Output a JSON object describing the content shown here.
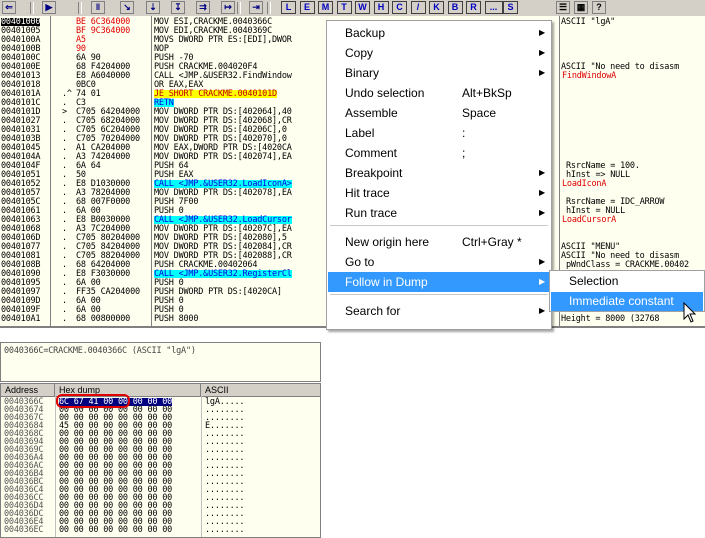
{
  "toolbar": {
    "buttons_left": [
      "⇐",
      "▶",
      "‖",
      "↘",
      "⇣",
      "↧",
      "⇉",
      "↦",
      "⇥"
    ],
    "letters": [
      "L",
      "E",
      "M",
      "T",
      "W",
      "H",
      "C",
      "/",
      "K",
      "B",
      "R",
      "...",
      "S"
    ],
    "right": [
      "☰",
      "▦",
      "?"
    ]
  },
  "cpu": {
    "rows": [
      {
        "addr": "00401000",
        "mark": "",
        "hex": "BE 6C364000",
        "asm": "MOV ESI,CRACKME.0040366C",
        "cmt": "ASCII \"lgA\"",
        "addr_hl": true,
        "hex_red": true
      },
      {
        "addr": "00401005",
        "mark": "",
        "hex": "BF 9C364000",
        "asm": "MOV EDI,CRACKME.0040369C",
        "cmt": "",
        "hex_red": true
      },
      {
        "addr": "0040100A",
        "mark": "",
        "hex": "A5",
        "asm": "MOVS DWORD PTR ES:[EDI],DWOR",
        "cmt": "",
        "hex_red": true
      },
      {
        "addr": "0040100B",
        "mark": "",
        "hex": "90",
        "asm": "NOP",
        "cmt": "",
        "hex_red": true
      },
      {
        "addr": "0040100C",
        "mark": "",
        "hex": "6A 90",
        "asm": "PUSH -70",
        "cmt": ""
      },
      {
        "addr": "0040100E",
        "mark": "",
        "hex": "68 F4204000",
        "asm": "PUSH CRACKME.004020F4",
        "cmt": "ASCII \"No need to disasm"
      },
      {
        "addr": "00401013",
        "mark": "",
        "hex": "E8 A6040000",
        "asm": "CALL <JMP.&USER32.FindWindow",
        "cmt": "FindWindowA",
        "cmt_red": true
      },
      {
        "addr": "00401018",
        "mark": "",
        "hex": "0BC0",
        "asm": "OR EAX,EAX",
        "cmt": ""
      },
      {
        "addr": "0040101A",
        "mark": ".^",
        "hex": "74 01",
        "asm": "JE SHORT CRACKME.0040101D",
        "cmt": "",
        "asm_style": "yellow"
      },
      {
        "addr": "0040101C",
        "mark": ".",
        "hex": "C3",
        "asm": "RETN",
        "cmt": "",
        "asm_style": "cyan"
      },
      {
        "addr": "0040101D",
        "mark": ">",
        "hex": "C705 64204000",
        "asm": "MOV DWORD PTR DS:[402064],40",
        "cmt": ""
      },
      {
        "addr": "00401027",
        "mark": ".",
        "hex": "C705 68204000",
        "asm": "MOV DWORD PTR DS:[402068],CR",
        "cmt": ""
      },
      {
        "addr": "00401031",
        "mark": ".",
        "hex": "C705 6C204000",
        "asm": "MOV DWORD PTR DS:[40206C],0",
        "cmt": ""
      },
      {
        "addr": "0040103B",
        "mark": ".",
        "hex": "C705 70204000",
        "asm": "MOV DWORD PTR DS:[402070],0",
        "cmt": ""
      },
      {
        "addr": "00401045",
        "mark": ".",
        "hex": "A1 CA204000",
        "asm": "MOV EAX,DWORD PTR DS:[4020CA",
        "cmt": ""
      },
      {
        "addr": "0040104A",
        "mark": ".",
        "hex": "A3 74204000",
        "asm": "MOV DWORD PTR DS:[402074],EA",
        "cmt": ""
      },
      {
        "addr": "0040104F",
        "mark": ".",
        "hex": "6A 64",
        "asm": "PUSH 64",
        "cmt": "RsrcName = 100.",
        "cmt_sub": true
      },
      {
        "addr": "00401051",
        "mark": ".",
        "hex": "50",
        "asm": "PUSH EAX",
        "cmt": "hInst => NULL",
        "cmt_sub": true
      },
      {
        "addr": "00401052",
        "mark": ".",
        "hex": "E8 D1030000",
        "asm": "CALL <JMP.&USER32.LoadIconA>",
        "cmt": "LoadIconA",
        "asm_style": "cyan",
        "cmt_red": true
      },
      {
        "addr": "00401057",
        "mark": ".",
        "hex": "A3 78204000",
        "asm": "MOV DWORD PTR DS:[402078],EA",
        "cmt": ""
      },
      {
        "addr": "0040105C",
        "mark": ".",
        "hex": "68 007F0000",
        "asm": "PUSH 7F00",
        "cmt": "RsrcName = IDC_ARROW",
        "cmt_sub": true
      },
      {
        "addr": "00401061",
        "mark": ".",
        "hex": "6A 00",
        "asm": "PUSH 0",
        "cmt": "hInst = NULL",
        "cmt_sub": true
      },
      {
        "addr": "00401063",
        "mark": ".",
        "hex": "E8 B0030000",
        "asm": "CALL <JMP.&USER32.LoadCursor",
        "cmt": "LoadCursorA",
        "asm_style": "cyan",
        "cmt_red": true
      },
      {
        "addr": "00401068",
        "mark": ".",
        "hex": "A3 7C204000",
        "asm": "MOV DWORD PTR DS:[40207C],EA",
        "cmt": ""
      },
      {
        "addr": "0040106D",
        "mark": ".",
        "hex": "C705 80204000",
        "asm": "MOV DWORD PTR DS:[402080],5",
        "cmt": ""
      },
      {
        "addr": "00401077",
        "mark": ".",
        "hex": "C705 84204000",
        "asm": "MOV DWORD PTR DS:[402084],CR",
        "cmt": "ASCII \"MENU\""
      },
      {
        "addr": "00401081",
        "mark": ".",
        "hex": "C705 88204000",
        "asm": "MOV DWORD PTR DS:[402088],CR",
        "cmt": "ASCII \"No need to disasm"
      },
      {
        "addr": "0040108B",
        "mark": ".",
        "hex": "68 64204000",
        "asm": "PUSH CRACKME.00402064",
        "cmt": "pWndClass = CRACKME.00402",
        "cmt_sub": true
      },
      {
        "addr": "00401090",
        "mark": ".",
        "hex": "E8 F3030000",
        "asm": "CALL <JMP.&USER32.RegisterCl",
        "cmt": "",
        "asm_style": "cyan"
      },
      {
        "addr": "00401095",
        "mark": ".",
        "hex": "6A 00",
        "asm": "PUSH 0",
        "cmt": ""
      },
      {
        "addr": "00401097",
        "mark": ".",
        "hex": "FF35 CA204000",
        "asm": "PUSH DWORD PTR DS:[4020CA]",
        "cmt": ""
      },
      {
        "addr": "0040109D",
        "mark": ".",
        "hex": "6A 00",
        "asm": "PUSH 0",
        "cmt": ""
      },
      {
        "addr": "0040109F",
        "mark": ".",
        "hex": "6A 00",
        "asm": "PUSH 0",
        "cmt": ""
      },
      {
        "addr": "004010A1",
        "mark": ".",
        "hex": "68 00800000",
        "asm": "PUSH 8000",
        "cmt": "Height = 8000 (32768"
      }
    ]
  },
  "menu": {
    "items": [
      {
        "label": "Backup",
        "shortcut": "",
        "arrow": true
      },
      {
        "label": "Copy",
        "shortcut": "",
        "arrow": true
      },
      {
        "label": "Binary",
        "shortcut": "",
        "arrow": true
      },
      {
        "label": "Undo selection",
        "shortcut": "Alt+BkSp",
        "arrow": false
      },
      {
        "label": "Assemble",
        "shortcut": "Space",
        "arrow": false
      },
      {
        "label": "Label",
        "shortcut": ":",
        "arrow": false
      },
      {
        "label": "Comment",
        "shortcut": ";",
        "arrow": false
      },
      {
        "label": "Breakpoint",
        "shortcut": "",
        "arrow": true
      },
      {
        "label": "Hit trace",
        "shortcut": "",
        "arrow": true
      },
      {
        "label": "Run trace",
        "shortcut": "",
        "arrow": true
      },
      {
        "label": "New origin here",
        "shortcut": "Ctrl+Gray *",
        "arrow": false
      },
      {
        "label": "Go to",
        "shortcut": "",
        "arrow": true
      },
      {
        "label": "Follow in Dump",
        "shortcut": "",
        "arrow": true,
        "active": true
      },
      {
        "label": "Search for",
        "shortcut": "",
        "arrow": true
      }
    ],
    "submenu": [
      {
        "label": "Selection",
        "active": false
      },
      {
        "label": "Immediate constant",
        "active": true
      }
    ]
  },
  "info": {
    "text": "0040366C=CRACKME.0040366C (ASCII \"lgA\")"
  },
  "dump": {
    "headers": [
      "Address",
      "Hex dump",
      "ASCII"
    ],
    "rows": [
      {
        "addr": "0040366C",
        "hex": "6C 67 41 00 00 00 00 00",
        "ascii": "lgA....."
      },
      {
        "addr": "00403674",
        "hex": "00 00 00 00 00 00 00 00",
        "ascii": "........"
      },
      {
        "addr": "0040367C",
        "hex": "00 00 00 00 00 00 00 00",
        "ascii": "........"
      },
      {
        "addr": "00403684",
        "hex": "45 00 00 00 00 00 00 00",
        "ascii": "E......."
      },
      {
        "addr": "0040368C",
        "hex": "00 00 00 00 00 00 00 00",
        "ascii": "........"
      },
      {
        "addr": "00403694",
        "hex": "00 00 00 00 00 00 00 00",
        "ascii": "........"
      },
      {
        "addr": "0040369C",
        "hex": "00 00 00 00 00 00 00 00",
        "ascii": "........"
      },
      {
        "addr": "004036A4",
        "hex": "00 00 00 00 00 00 00 00",
        "ascii": "........"
      },
      {
        "addr": "004036AC",
        "hex": "00 00 00 00 00 00 00 00",
        "ascii": "........"
      },
      {
        "addr": "004036B4",
        "hex": "00 00 00 00 00 00 00 00",
        "ascii": "........"
      },
      {
        "addr": "004036BC",
        "hex": "00 00 00 00 00 00 00 00",
        "ascii": "........"
      },
      {
        "addr": "004036C4",
        "hex": "00 00 00 00 00 00 00 00",
        "ascii": "........"
      },
      {
        "addr": "004036CC",
        "hex": "00 00 00 00 00 00 00 00",
        "ascii": "........"
      },
      {
        "addr": "004036D4",
        "hex": "00 00 00 00 00 00 00 00",
        "ascii": "........"
      },
      {
        "addr": "004036DC",
        "hex": "00 00 00 00 00 00 00 00",
        "ascii": "........"
      },
      {
        "addr": "004036E4",
        "hex": "00 00 00 00 00 00 00 00",
        "ascii": "........"
      },
      {
        "addr": "004036EC",
        "hex": "00 00 00 00 00 00 00 00",
        "ascii": "........"
      }
    ]
  },
  "colors": {
    "menu_highlight": "#3399ff",
    "selection_dark": "#000080",
    "annotation_red": "#e00000",
    "jump_yellow": "#ffff00",
    "call_cyan": "#00ffff"
  }
}
